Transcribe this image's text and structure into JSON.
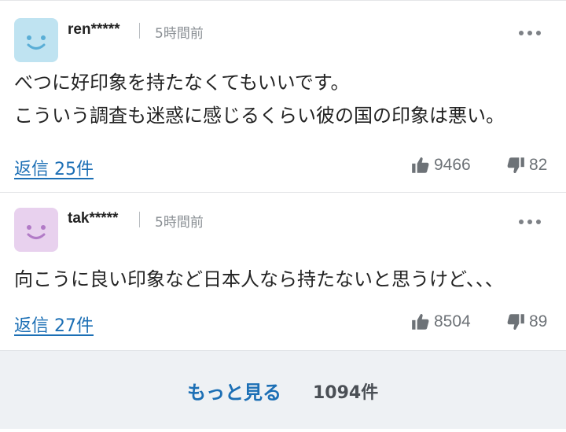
{
  "comments": [
    {
      "username": "ren*****",
      "time": "5時間前",
      "avatar_color": "#bfe3f1",
      "avatar_face_color": "#5aaed6",
      "lines": [
        "べつに好印象を持たなくてもいいです。",
        "こういう調査も迷惑に感じるくらい彼の国の印象は悪い。"
      ],
      "reply_label": "返信 25件",
      "likes": "9466",
      "dislikes": "82"
    },
    {
      "username": "tak*****",
      "time": "5時間前",
      "avatar_color": "#e8d1ee",
      "avatar_face_color": "#b27bc7",
      "lines": [
        "向こうに良い印象など日本人なら持たないと思うけど、、、"
      ],
      "reply_label": "返信 27件",
      "likes": "8504",
      "dislikes": "89"
    }
  ],
  "footer": {
    "more_label": "もっと見る",
    "total_count": "1094件"
  },
  "colors": {
    "link": "#1c6fb5",
    "footer_bg": "#eef1f4"
  }
}
